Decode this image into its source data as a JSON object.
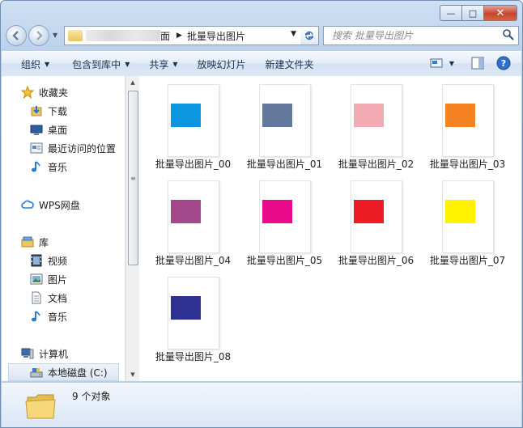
{
  "window": {
    "caption_buttons": {
      "minimize": "—",
      "maximize": "□",
      "close": "✕"
    }
  },
  "address": {
    "crumbs": [
      "面",
      "批量导出图片"
    ]
  },
  "search": {
    "placeholder": "搜索 批量导出图片"
  },
  "toolbar": {
    "organize": "组织",
    "include_in_library": "包含到库中",
    "share": "共享",
    "slideshow": "放映幻灯片",
    "new_folder": "新建文件夹"
  },
  "nav": {
    "favorites": "收藏夹",
    "downloads": "下载",
    "desktop": "桌面",
    "recent": "最近访问的位置",
    "music_fav": "音乐",
    "wps": "WPS网盘",
    "libraries": "库",
    "videos": "视频",
    "pictures": "图片",
    "documents": "文档",
    "music": "音乐",
    "computer": "计算机",
    "local_disk": "本地磁盘 (C:)"
  },
  "files": [
    {
      "name": "批量导出图片_00",
      "color": "#0b96df"
    },
    {
      "name": "批量导出图片_01",
      "color": "#63799b"
    },
    {
      "name": "批量导出图片_02",
      "color": "#f2aab3"
    },
    {
      "name": "批量导出图片_03",
      "color": "#f58220"
    },
    {
      "name": "批量导出图片_04",
      "color": "#a3488b"
    },
    {
      "name": "批量导出图片_05",
      "color": "#e90b8c"
    },
    {
      "name": "批量导出图片_06",
      "color": "#ee1c25"
    },
    {
      "name": "批量导出图片_07",
      "color": "#fff100"
    },
    {
      "name": "批量导出图片_08",
      "color": "#2e3092"
    }
  ],
  "details": {
    "count": "9 个对象"
  }
}
